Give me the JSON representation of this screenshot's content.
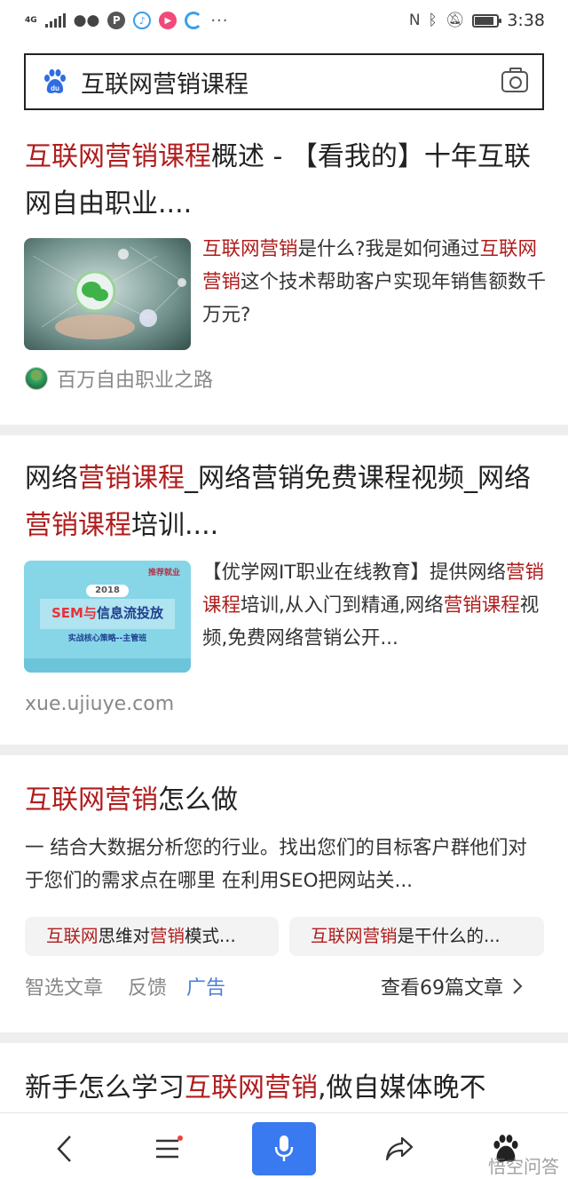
{
  "status": {
    "network": "4G",
    "time": "3:38",
    "battery_level": 0.85
  },
  "search": {
    "query": "互联网营销课程"
  },
  "results": [
    {
      "title_parts": [
        {
          "t": "互联网营销课程",
          "hl": true
        },
        {
          "t": "概述 - 【看我的】十年互联网自由职业....",
          "hl": false
        }
      ],
      "snippet_parts": [
        {
          "t": "互联网营销",
          "hl": true
        },
        {
          "t": "是什么?我是如何通过",
          "hl": false
        },
        {
          "t": "互联网营销",
          "hl": true
        },
        {
          "t": "这个技术帮助客户实现年销售额数千万元?",
          "hl": false
        }
      ],
      "source": "百万自由职业之路"
    },
    {
      "title_parts": [
        {
          "t": "网络",
          "hl": false
        },
        {
          "t": "营销课程",
          "hl": true
        },
        {
          "t": "_网络营销免费课程视频_网络",
          "hl": false
        },
        {
          "t": "营销课程",
          "hl": true
        },
        {
          "t": "培训....",
          "hl": false
        }
      ],
      "thumb_text": {
        "badge": "推荐就业",
        "year": "2018",
        "headline_a": "SEM与",
        "headline_b": "信息流投放",
        "sub": "实战核心策略--主管班"
      },
      "snippet_parts": [
        {
          "t": "【优学网IT职业在线教育】提供网络",
          "hl": false
        },
        {
          "t": "营销课程",
          "hl": true
        },
        {
          "t": "培训,从入门到精通,网络",
          "hl": false
        },
        {
          "t": "营销课程",
          "hl": true
        },
        {
          "t": "视频,免费网络营销公开...",
          "hl": false
        }
      ],
      "source": "xue.ujiuye.com"
    },
    {
      "title_parts": [
        {
          "t": "互联网营销",
          "hl": true
        },
        {
          "t": "怎么做",
          "hl": false
        }
      ],
      "snippet": "一 结合大数据分析您的行业。找出您们的目标客户群他们对于您们的需求点在哪里 在利用SEO把网站关...",
      "chips": [
        [
          {
            "t": "互联网",
            "hl": true
          },
          {
            "t": "思维对",
            "hl": false
          },
          {
            "t": "营销",
            "hl": true
          },
          {
            "t": "模式...",
            "hl": false
          }
        ],
        [
          {
            "t": "互联网营销",
            "hl": true
          },
          {
            "t": "是干什么的...",
            "hl": false
          }
        ]
      ],
      "meta": {
        "source": "智选文章",
        "feedback": "反馈",
        "ad": "广告",
        "more": "查看69篇文章"
      }
    },
    {
      "title_parts": [
        {
          "t": "新手怎么学习",
          "hl": false
        },
        {
          "t": "互联网营销",
          "hl": true
        },
        {
          "t": ",做自媒体晚不",
          "hl": false
        }
      ]
    }
  ],
  "watermark": "悟空问答",
  "colors": {
    "highlight": "#b01c1c",
    "accent": "#3a7af0",
    "ad": "#4a7fd8"
  }
}
